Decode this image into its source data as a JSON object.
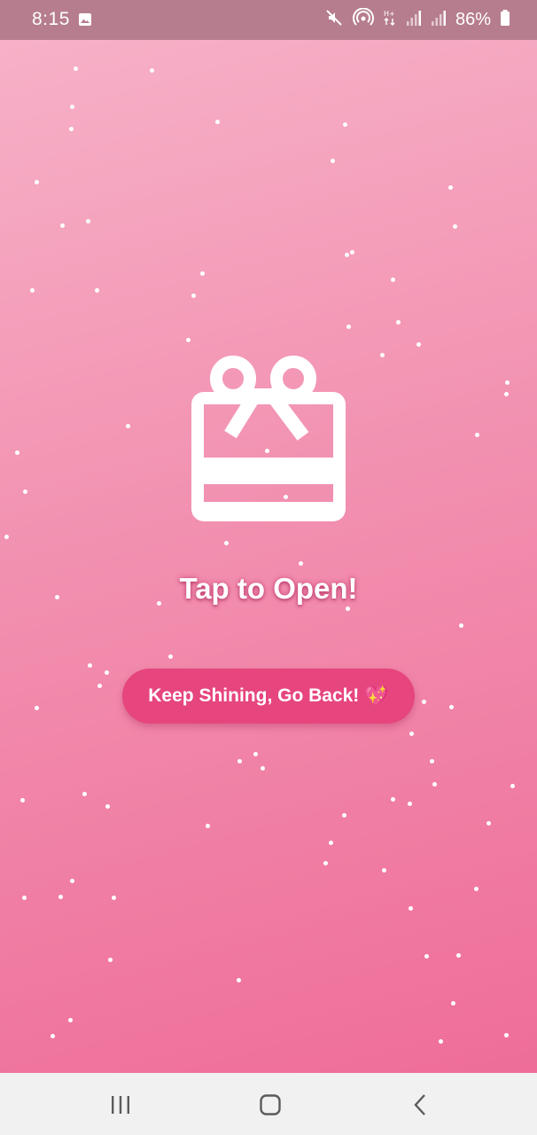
{
  "status_bar": {
    "time": "8:15",
    "battery": "86%",
    "icons": [
      "gallery-icon",
      "mute-icon",
      "hotspot-icon",
      "hplus-data-icon",
      "signal-icon",
      "signal-icon-2",
      "battery-icon"
    ]
  },
  "main": {
    "title": "Tap to Open!",
    "back_button_label": "Keep Shining, Go Back!",
    "back_button_emoji": "💖",
    "gift_icon": "gift-icon"
  },
  "nav_bar": {
    "buttons": [
      "recent-apps",
      "home",
      "back"
    ]
  },
  "colors": {
    "background_top": "#f7b3c9",
    "background_bottom": "#ee6a97",
    "button": "#e6457e",
    "status_bar": "#b67d8e",
    "nav_bar": "#f2f1f1"
  }
}
